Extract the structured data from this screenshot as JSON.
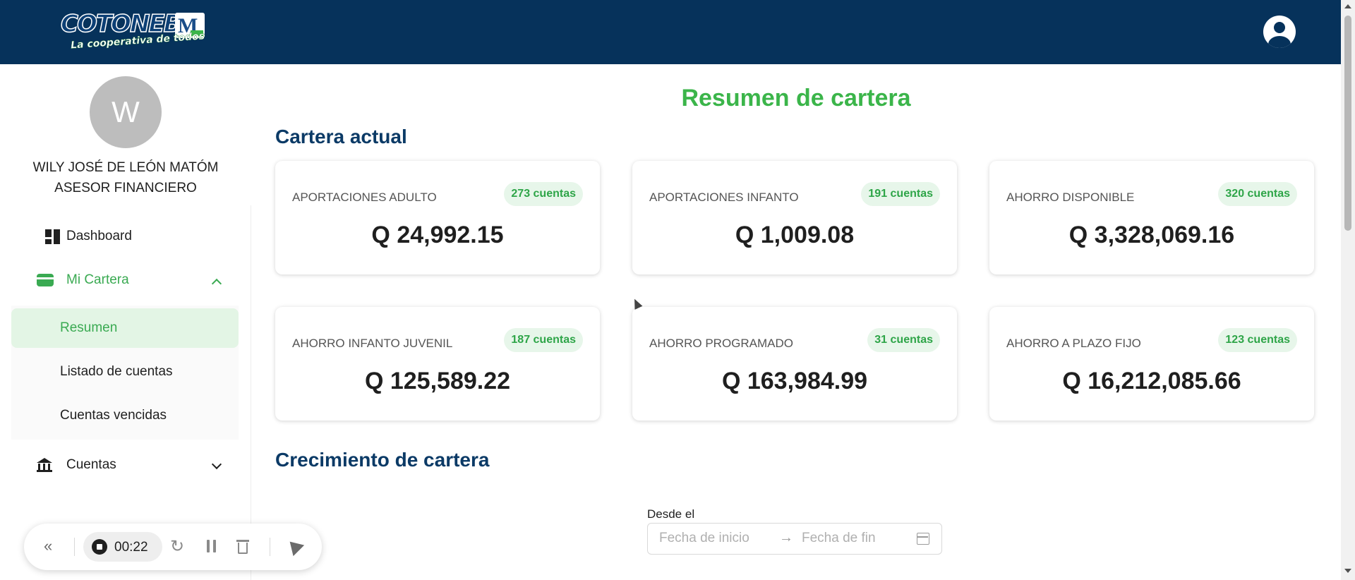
{
  "header": {
    "logo": {
      "brand_text": "COTONEB",
      "badge_text": "M",
      "slogan": "La cooperativa de todos"
    },
    "user_menu_icon": "user-circle-icon",
    "colors": {
      "header_bg": "#06325b",
      "accent": "#3bb54a"
    }
  },
  "sidebar": {
    "avatar_initial": "W",
    "user_name": "WILY JOSÉ DE LEÓN MATÓM",
    "user_role": "ASESOR FINANCIERO",
    "items": [
      {
        "label": "Dashboard",
        "icon": "dashboard-icon"
      },
      {
        "label": "Mi Cartera",
        "icon": "wallet-icon",
        "expanded": true,
        "children": [
          {
            "label": "Resumen",
            "active": true
          },
          {
            "label": "Listado de cuentas"
          },
          {
            "label": "Cuentas vencidas"
          }
        ]
      },
      {
        "label": "Cuentas",
        "icon": "bank-icon",
        "expanded": false
      }
    ]
  },
  "main": {
    "page_title": "Resumen de cartera",
    "section_current": "Cartera actual",
    "cards": [
      {
        "label": "APORTACIONES ADULTO",
        "badge": "273 cuentas",
        "amount": "Q 24,992.15"
      },
      {
        "label": "APORTACIONES INFANTO",
        "badge": "191 cuentas",
        "amount": "Q 1,009.08"
      },
      {
        "label": "AHORRO DISPONIBLE",
        "badge": "320 cuentas",
        "amount": "Q 3,328,069.16"
      },
      {
        "label": "AHORRO INFANTO JUVENIL",
        "badge": "187 cuentas",
        "amount": "Q 125,589.22"
      },
      {
        "label": "AHORRO PROGRAMADO",
        "badge": "31 cuentas",
        "amount": "Q 163,984.99"
      },
      {
        "label": "AHORRO A PLAZO FIJO",
        "badge": "123 cuentas",
        "amount": "Q 16,212,085.66"
      }
    ],
    "section_growth": "Crecimiento de cartera",
    "date_filter": {
      "label": "Desde el",
      "start_placeholder": "Fecha de inicio",
      "arrow": "→",
      "end_placeholder": "Fecha de fin",
      "icon": "calendar-icon"
    }
  },
  "recorder": {
    "collapse": "«",
    "time": "00:22",
    "restart": "↻",
    "icons": [
      "stop-icon",
      "restart-icon",
      "pause-icon",
      "trash-icon",
      "pointer-icon"
    ]
  }
}
